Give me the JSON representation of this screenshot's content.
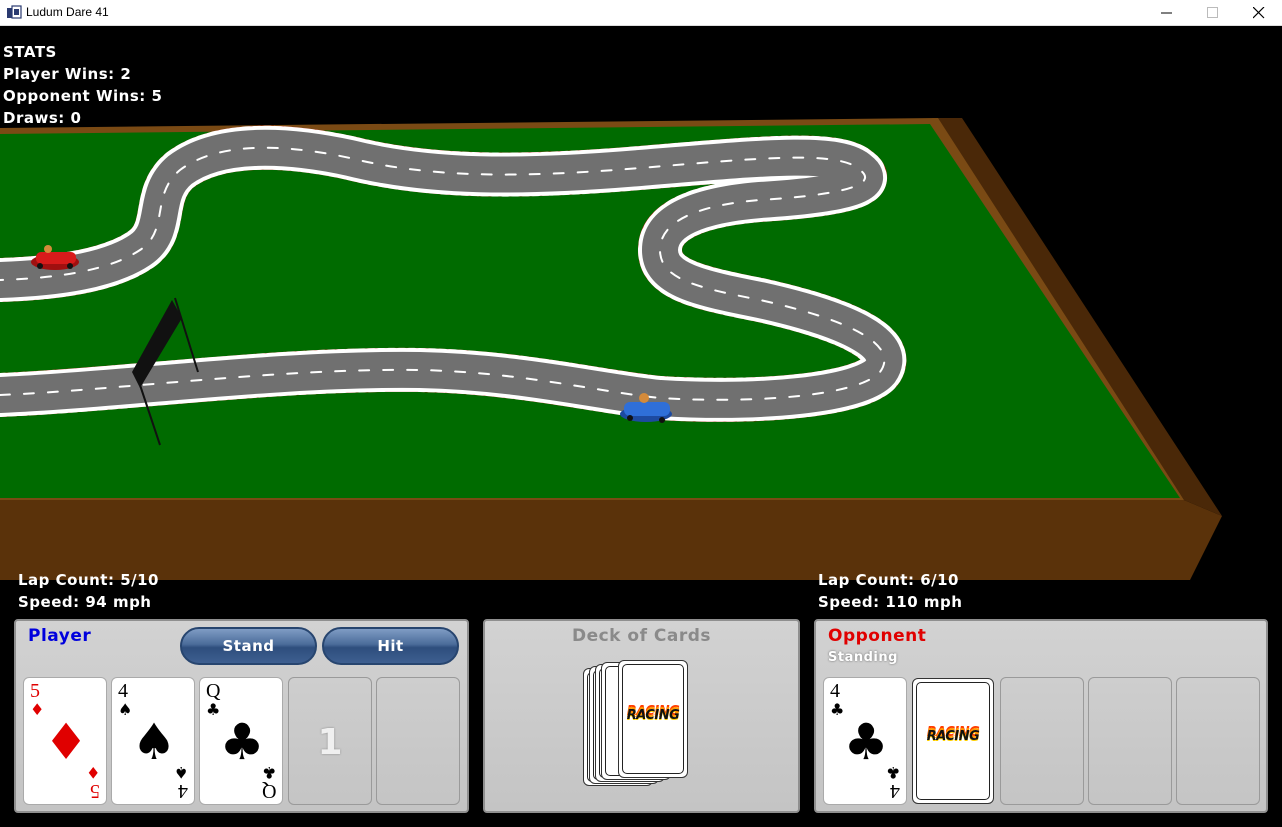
{
  "window": {
    "title": "Ludum Dare 41"
  },
  "stats": {
    "heading": "STATS",
    "player_wins": "Player Wins: 2",
    "opponent_wins": "Opponent Wins: 5",
    "draws": "Draws: 0"
  },
  "player_hud": {
    "lap": "Lap Count: 5/10",
    "speed": "Speed: 94 mph"
  },
  "opponent_hud": {
    "lap": "Lap Count: 6/10",
    "speed": "Speed: 110 mph"
  },
  "player_panel": {
    "title": "Player",
    "stand_label": "Stand",
    "hit_label": "Hit",
    "cards": [
      {
        "rank": "5",
        "suit": "♦",
        "color": "red"
      },
      {
        "rank": "4",
        "suit": "♠",
        "color": "black"
      },
      {
        "rank": "Q",
        "suit": "♣",
        "color": "black"
      }
    ],
    "empty_slot_number": "1"
  },
  "deck_panel": {
    "title": "Deck of Cards",
    "card_back_logo": "RACING"
  },
  "opponent_panel": {
    "title": "Opponent",
    "status": "Standing",
    "cards": [
      {
        "rank": "4",
        "suit": "♣",
        "color": "black"
      }
    ],
    "hidden_card_logo": "RACING"
  },
  "colors": {
    "player_title": "#0000dd",
    "opponent_title": "#e00000",
    "deck_title": "#8a8a8a",
    "table_top": "#006b00",
    "table_side": "#5a320a",
    "track": "#6e6e6e",
    "kerb_red": "#d81b1b",
    "player_car": "#2f6fd8",
    "opponent_car": "#d81b1b"
  }
}
